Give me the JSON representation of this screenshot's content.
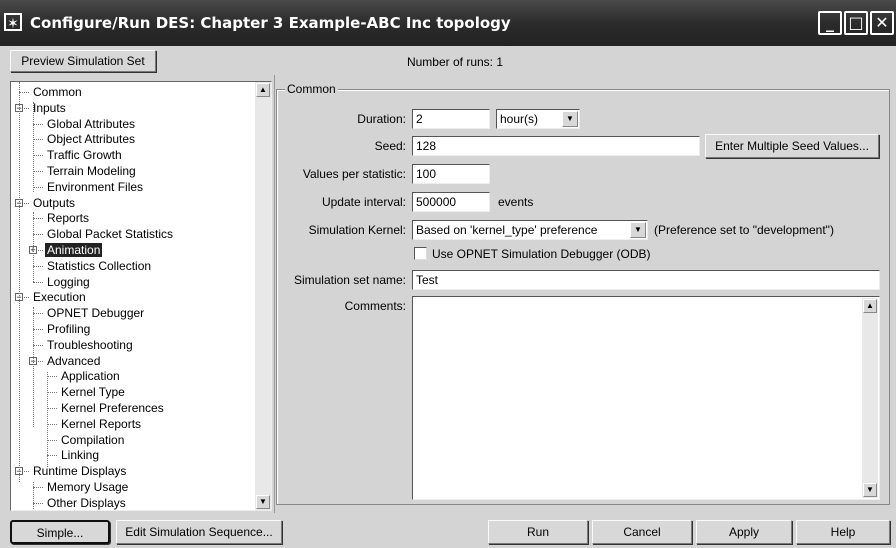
{
  "window": {
    "title": "Configure/Run DES: Chapter 3 Example-ABC Inc topology",
    "icon_glyph": "✶",
    "minimize_glyph": "_",
    "maximize_glyph": "□",
    "close_glyph": "✕"
  },
  "toolbar": {
    "preview_label": "Preview Simulation Set",
    "runs_label": "Number of runs: 1"
  },
  "tree": {
    "items": [
      {
        "label": "Common"
      },
      {
        "label": "Inputs"
      },
      {
        "label": "Global Attributes"
      },
      {
        "label": "Object Attributes"
      },
      {
        "label": "Traffic Growth"
      },
      {
        "label": "Terrain Modeling"
      },
      {
        "label": "Environment Files"
      },
      {
        "label": "Outputs"
      },
      {
        "label": "Reports"
      },
      {
        "label": "Global Packet Statistics"
      },
      {
        "label": "Animation",
        "selected": true
      },
      {
        "label": "Statistics Collection"
      },
      {
        "label": "Logging"
      },
      {
        "label": "Execution"
      },
      {
        "label": "OPNET Debugger"
      },
      {
        "label": "Profiling"
      },
      {
        "label": "Troubleshooting"
      },
      {
        "label": "Advanced"
      },
      {
        "label": "Application"
      },
      {
        "label": "Kernel Type"
      },
      {
        "label": "Kernel Preferences"
      },
      {
        "label": "Kernel Reports"
      },
      {
        "label": "Compilation"
      },
      {
        "label": "Linking"
      },
      {
        "label": "Runtime Displays"
      },
      {
        "label": "Memory Usage"
      },
      {
        "label": "Other Displays"
      }
    ]
  },
  "common": {
    "group_label": "Common",
    "duration_label": "Duration:",
    "duration_value": "2",
    "duration_unit": "hour(s)",
    "seed_label": "Seed:",
    "seed_value": "128",
    "multiple_seed_button": "Enter Multiple Seed Values...",
    "values_per_stat_label": "Values per statistic:",
    "values_per_stat_value": "100",
    "update_interval_label": "Update interval:",
    "update_interval_value": "500000",
    "update_interval_unit": "events",
    "kernel_label": "Simulation Kernel:",
    "kernel_value": "Based on 'kernel_type' preference",
    "kernel_note": "(Preference set to \"development\")",
    "debugger_checkbox_label": "Use OPNET Simulation Debugger (ODB)",
    "debugger_checked": false,
    "set_name_label": "Simulation set name:",
    "set_name_value": "Test",
    "comments_label": "Comments:",
    "comments_value": ""
  },
  "footer": {
    "simple_label": "Simple...",
    "edit_sequence_label": "Edit Simulation Sequence...",
    "run_label": "Run",
    "cancel_label": "Cancel",
    "apply_label": "Apply",
    "help_label": "Help"
  }
}
